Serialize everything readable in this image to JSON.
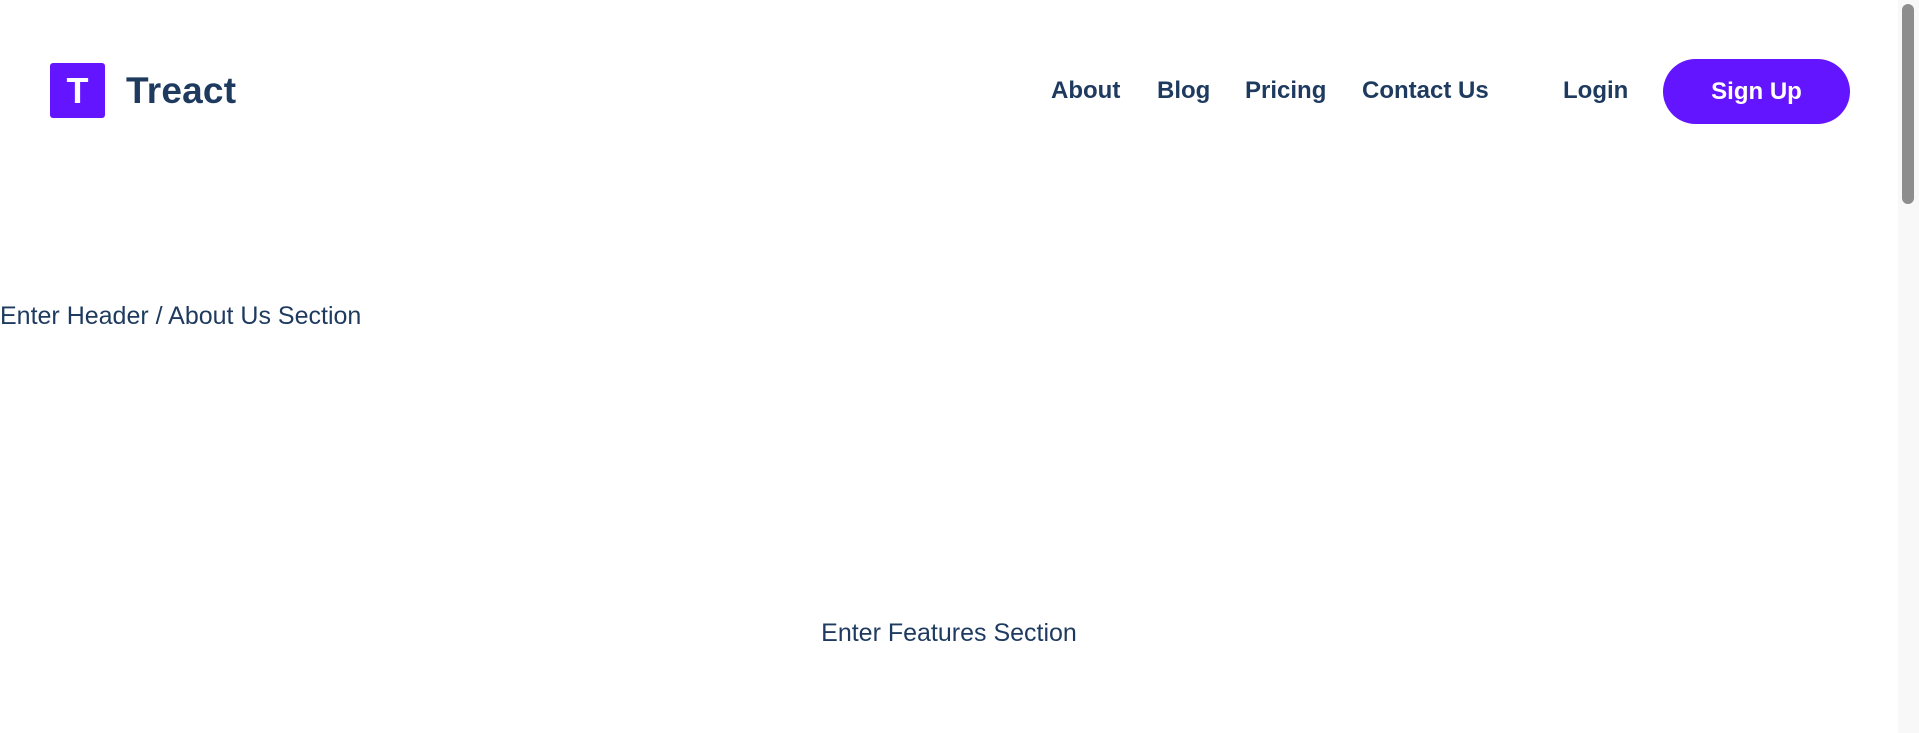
{
  "header": {
    "brand": {
      "logo_letter": "T",
      "name": "Treact",
      "logo_color": "#6415ff"
    },
    "nav": {
      "about": "About",
      "blog": "Blog",
      "pricing": "Pricing",
      "contact": "Contact Us",
      "login": "Login",
      "signup": "Sign Up"
    },
    "accent_color": "#6415ff",
    "text_color": "#1e3a5f"
  },
  "main": {
    "header_section_text": "Enter Header / About Us Section",
    "features_section_text": "Enter Features Section"
  }
}
